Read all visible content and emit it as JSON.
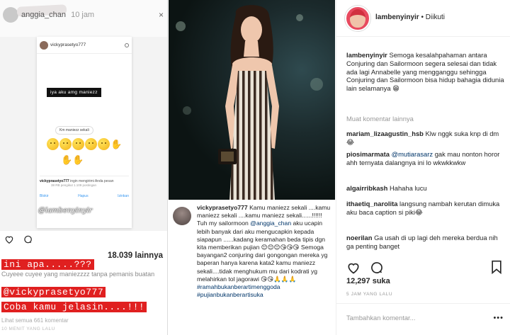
{
  "story": {
    "username": "anggia_chan",
    "time": "10 jam",
    "close_glyph": "×",
    "dm": {
      "header_user": "vickyprasetyo777",
      "bubble": "iya aku amg maniezz",
      "small_bubble": "Km maniezz sekali",
      "request_user": "vickyprasetyo777",
      "request_text": "ingin mengirimi Anda pesan",
      "request_sub": "38 RB pengikut  1.109 postingan",
      "btn_block": "Blokir",
      "btn_delete": "Hapus",
      "btn_allow": "Izinkan"
    },
    "watermark": "@lambenyinyir",
    "likes": "18.039 lainnya",
    "caption_blur": "Cuyeee cuyee yang maniezzzz tanpa pemanis buatan",
    "comment_blur": "Lihat semua 661 komentar",
    "time_ago": "10 MENIT YANG LALU",
    "overlay": {
      "line1": "ini apa.....???",
      "line2": "@vickyprasetyo777",
      "line3": "Coba kamu jelasin....!!!"
    }
  },
  "middle": {
    "comment_user": "vickyprasetyo777",
    "comment_text_a": "Kamu maniezz sekali ....kamu maniezz sekali ....kamu maniezz sekali......!!!!!! Tuh my sailormoon",
    "comment_mention": "@anggia_chan",
    "comment_text_b": "aku ucapin lebih banyak dari aku mengucapkin kepada siapapun ......kadang keramahan beda tipis dgn kita memberikan pujian",
    "comment_emojis": "😊😊😊😘😘😘",
    "comment_text_c": "Semoga bayangan2 conjuring dari gongongan mereka yg baperan hanya karena kata2 kamu maniezz sekali....tidak menghukum mu dari kodrati yg melahirkan tol jagorawi",
    "comment_emojis2": "😘😘🙏🙏🙏",
    "hashtag1": "#ramahbukanberartimenggoda",
    "hashtag2": "#pujianbukanberartisuka"
  },
  "post": {
    "username": "lambenyinyir",
    "separator": "•",
    "follow_status": "Diikuti",
    "caption_user": "lambenyinyir",
    "caption_text": "Semoga kesalahpahaman antara Conjuring dan Sailormoon segera selesai dan tidak ada lagi Annabelle yang mengganggu sehingga Conjuring dan Sailormoon bisa hidup bahagia didunia lain selamanya",
    "caption_emoji": "😁",
    "more_comments": "Muat komentar lainnya",
    "comments": [
      {
        "user": "mariam_lizaagustin_hsb",
        "mention": "",
        "text": "Klw nggk suka knp di dm😂"
      },
      {
        "user": "piosimarmata",
        "mention": "@mutiarasarz",
        "text": "gak mau nonton horor ahh ternyata dalangnya ini lo wkwkkwkw"
      },
      {
        "user": "algairribkash",
        "mention": "",
        "text": "Hahaha lucu"
      },
      {
        "user": "ithaetiq_narolita",
        "mention": "",
        "text": "langsung nambah kerutan dimuka aku baca caption si piki😂"
      },
      {
        "user": "noerilan",
        "mention": "",
        "text": "Ga usah di up lagi deh mereka berdua nih ga penting banget"
      }
    ],
    "likes": "12,297 suka",
    "time_ago": "5 JAM YANG LALU",
    "comment_placeholder": "Tambahkan komentar...",
    "more_glyph": "•••"
  }
}
